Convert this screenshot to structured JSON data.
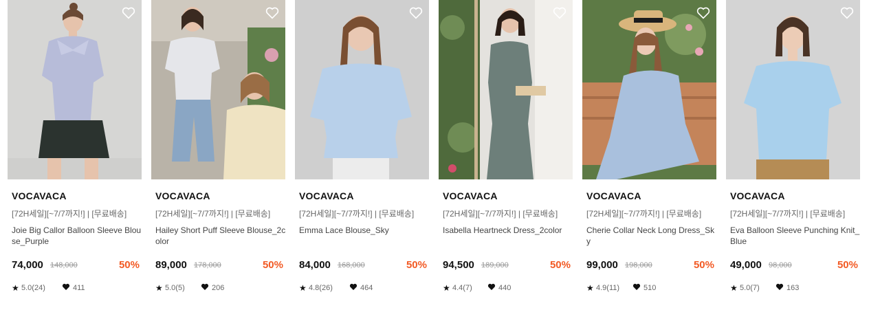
{
  "products": [
    {
      "brand": "VOCAVACA",
      "promo": "[72H세일][~7/7까지!] | [무료배송]",
      "name": "Joie Big Callor Balloon Sleeve Blouse_Purple",
      "price": "74,000",
      "original_price": "148,000",
      "discount": "50%",
      "rating": "5.0(24)",
      "likes": "411",
      "image": "model-purple-blouse"
    },
    {
      "brand": "VOCAVACA",
      "promo": "[72H세일][~7/7까지!] | [무료배송]",
      "name": "Hailey Short Puff Sleeve Blouse_2color",
      "price": "89,000",
      "original_price": "178,000",
      "discount": "50%",
      "rating": "5.0(5)",
      "likes": "206",
      "image": "models-garden-blouse"
    },
    {
      "brand": "VOCAVACA",
      "promo": "[72H세일][~7/7까지!] | [무료배송]",
      "name": "Emma Lace Blouse_Sky",
      "price": "84,000",
      "original_price": "168,000",
      "discount": "50%",
      "rating": "4.8(26)",
      "likes": "464",
      "image": "model-sky-blouse"
    },
    {
      "brand": "VOCAVACA",
      "promo": "[72H세일][~7/7까지!] | [무료배송]",
      "name": "Isabella Heartneck Dress_2color",
      "price": "94,500",
      "original_price": "189,000",
      "discount": "50%",
      "rating": "4.4(7)",
      "likes": "440",
      "image": "model-floral-dress"
    },
    {
      "brand": "VOCAVACA",
      "promo": "[72H세일][~7/7까지!] | [무료배송]",
      "name": "Cherie Collar Neck Long Dress_Sky",
      "price": "99,000",
      "original_price": "198,000",
      "discount": "50%",
      "rating": "4.9(11)",
      "likes": "510",
      "image": "model-gingham-dress"
    },
    {
      "brand": "VOCAVACA",
      "promo": "[72H세일][~7/7까지!] | [무료배송]",
      "name": "Eva Balloon Sleeve Punching Knit_Blue",
      "price": "49,000",
      "original_price": "98,000",
      "discount": "50%",
      "rating": "5.0(7)",
      "likes": "163",
      "image": "model-blue-knit"
    }
  ],
  "colors": {
    "discount": "#f25a24",
    "price": "#111111",
    "muted": "#999999"
  }
}
